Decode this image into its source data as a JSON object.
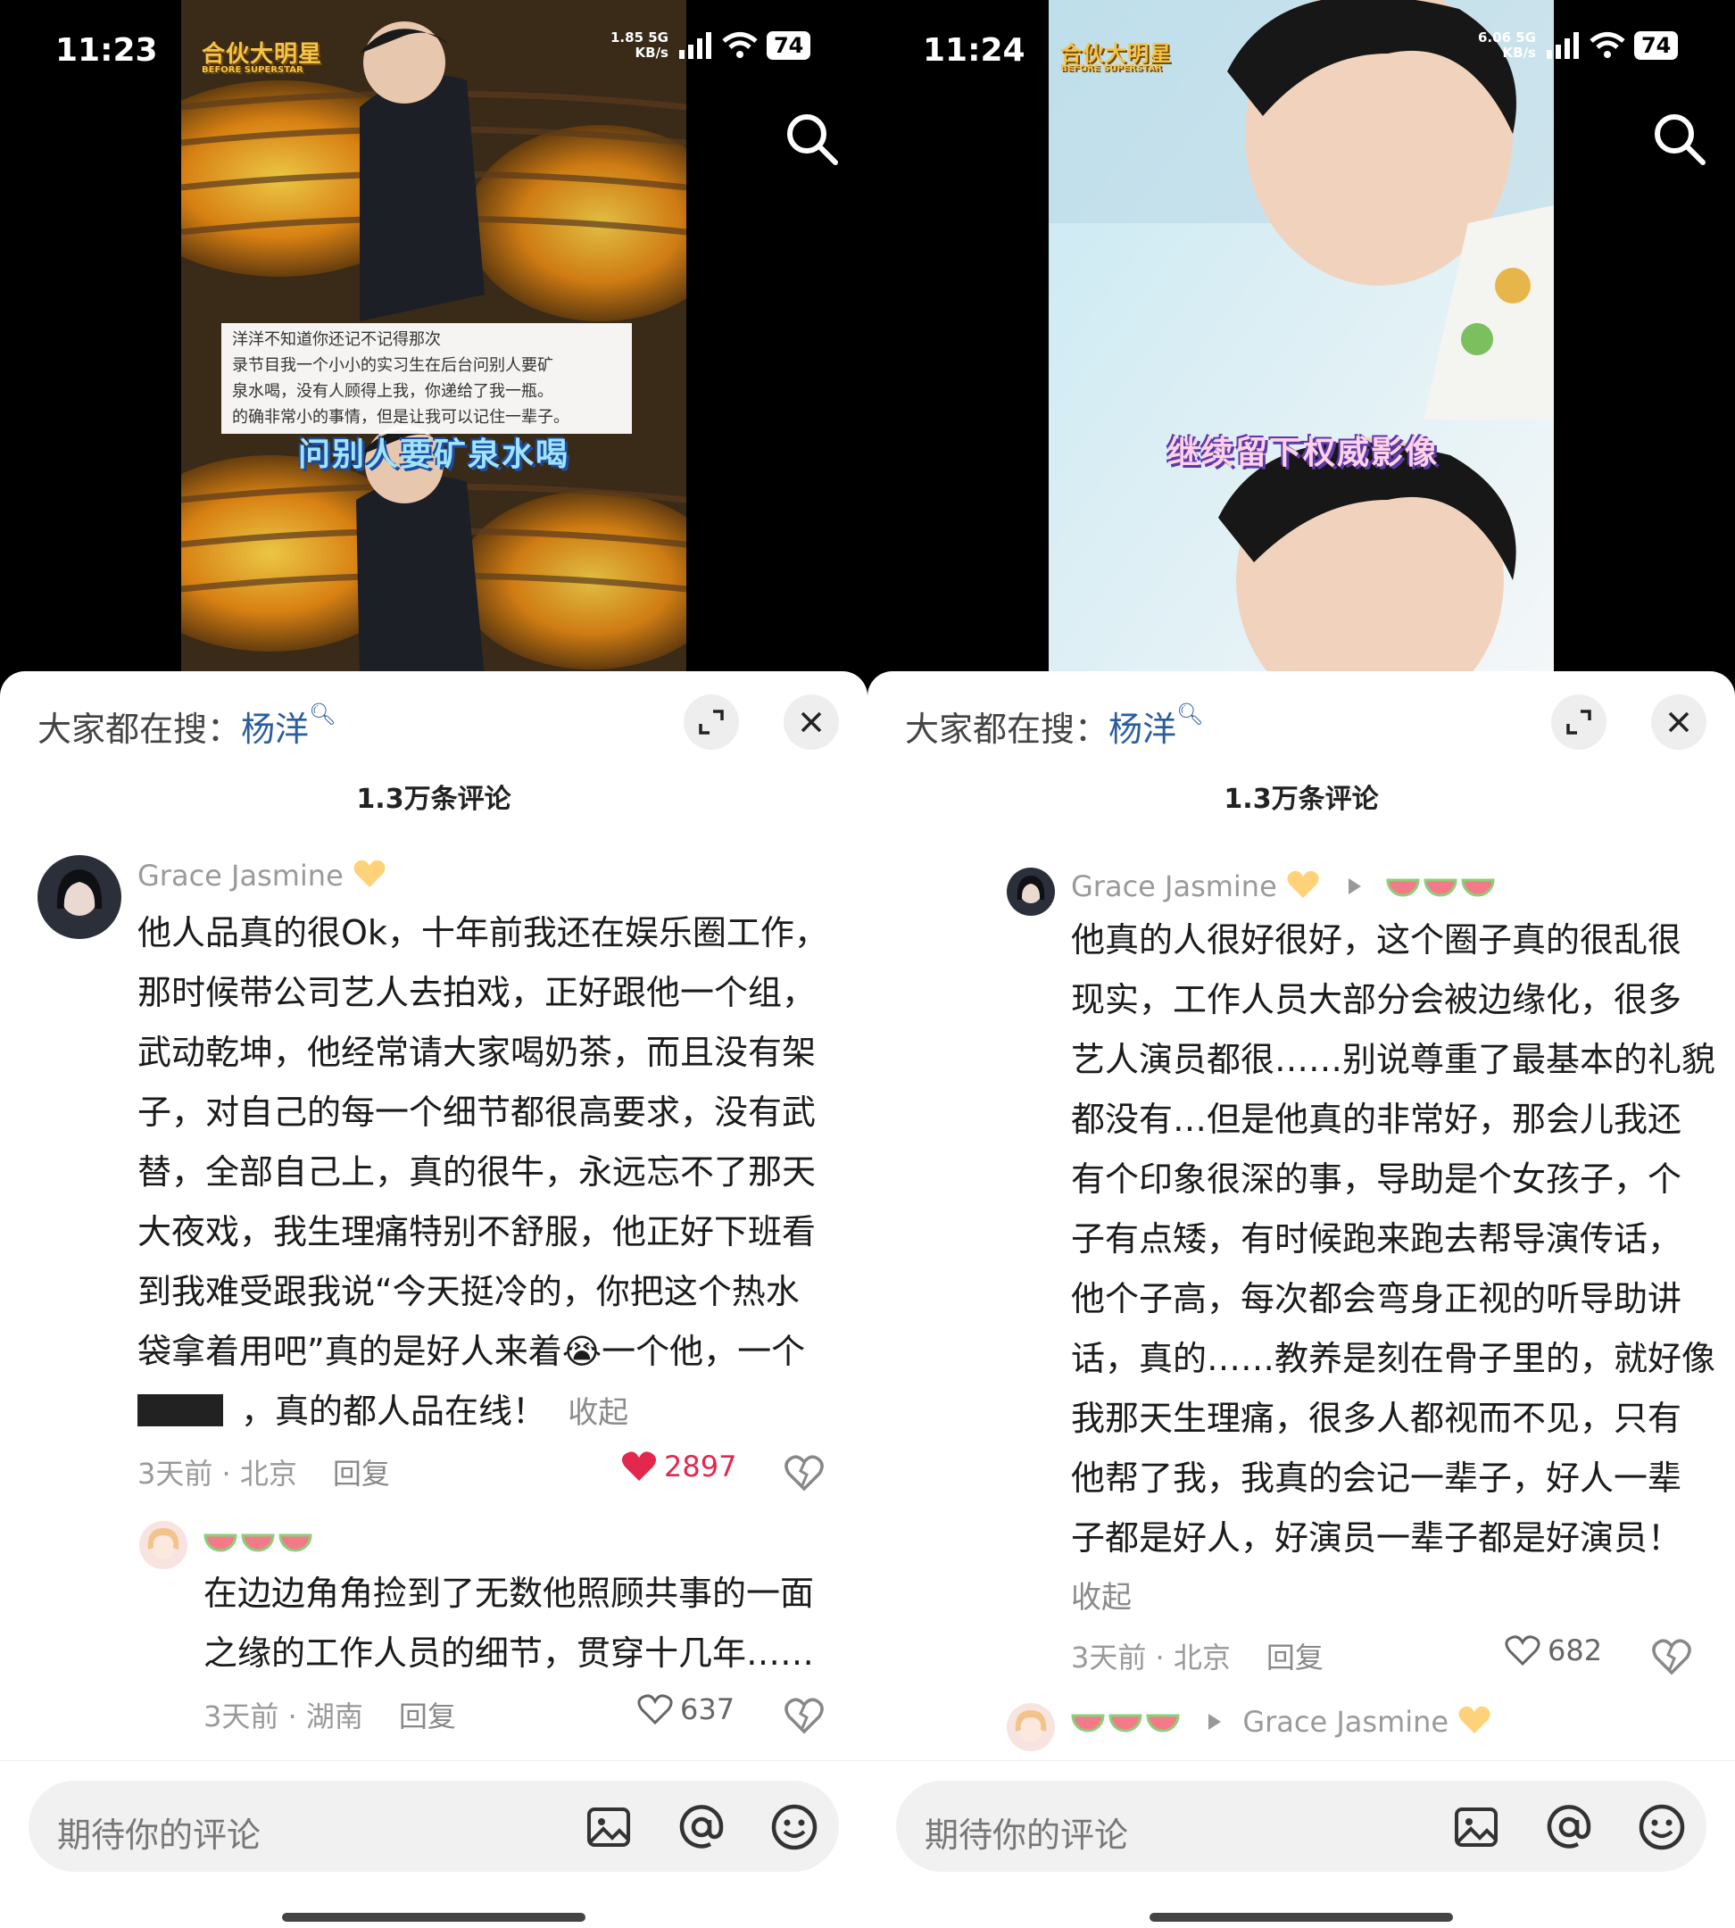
{
  "left": {
    "status": {
      "time": "11:23",
      "speed_top": "1.85 5G",
      "speed_unit": "KB/s",
      "battery": "74"
    },
    "video": {
      "logo": "合伙大明星",
      "logo_sub": "BEFORE SUPERSTAR",
      "caption_lines": [
        "洋洋不知道你还记不记得那次",
        "录节目我一个小小的实习生在后台问别人要矿",
        "泉水喝，没有人顾得上我，你递给了我一瓶。",
        "的确非常小的事情，但是让我可以记住一辈子。"
      ],
      "subtitle": "问别人要矿泉水喝"
    },
    "panel": {
      "trend_prefix": "大家都在搜：",
      "trend_keyword": "杨洋",
      "comment_count": "1.3万条评论",
      "comment": {
        "user": "Grace Jasmine",
        "lines": [
          "他人品真的很Ok，十年前我还在娱乐圈工作，",
          "那时候带公司艺人去拍戏，正好跟他一个组，",
          "武动乾坤，他经常请大家喝奶茶，而且没有架",
          "子，对自己的每一个细节都很高要求，没有武",
          "替，全部自己上，真的很牛，永远忘不了那天",
          "大夜戏，我生理痛特别不舒服，他正好下班看",
          "到我难受跟我说“今天挺冷的，你把这个热水",
          "袋拿着用吧”真的是好人来着😭一个他，一个"
        ],
        "last_line": "，真的都人品在线！",
        "fold": "收起",
        "time_loc": "3天前 · 北京",
        "reply": "回复",
        "likes": "2897"
      },
      "reply": {
        "lines": [
          "在边边角角捡到了无数他照顾共事的一面",
          "之缘的工作人员的细节，贯穿十几年……"
        ],
        "time_loc": "3天前 · 湖南",
        "reply": "回复",
        "likes": "637"
      },
      "input_placeholder": "期待你的评论"
    }
  },
  "right": {
    "status": {
      "time": "11:24",
      "speed_top": "6.06 5G",
      "speed_unit": "KB/s",
      "battery": "74"
    },
    "video": {
      "logo": "合伙大明星",
      "logo_sub": "BEFORE SUPERSTAR",
      "subtitle": "继续留下权威影像"
    },
    "panel": {
      "trend_prefix": "大家都在搜：",
      "trend_keyword": "杨洋",
      "comment_count": "1.3万条评论",
      "comment": {
        "user": "Grace Jasmine",
        "lines": [
          "他真的人很好很好，这个圈子真的很乱很",
          "现实，工作人员大部分会被边缘化，很多",
          "艺人演员都很……别说尊重了最基本的礼貌",
          "都没有…但是他真的非常好，那会儿我还",
          "有个印象很深的事，导助是个女孩子，个",
          "子有点矮，有时候跑来跑去帮导演传话，",
          "他个子高，每次都会弯身正视的听导助讲",
          "话，真的……教养是刻在骨子里的，就好像",
          "我那天生理痛，很多人都视而不见，只有",
          "他帮了我，我真的会记一辈子，好人一辈",
          "子都是好人，好演员一辈子都是好演员！"
        ],
        "fold": "收起",
        "time_loc": "3天前 · 北京",
        "reply": "回复",
        "likes": "682"
      },
      "next_reply_target": "Grace Jasmine",
      "input_placeholder": "期待你的评论"
    }
  }
}
